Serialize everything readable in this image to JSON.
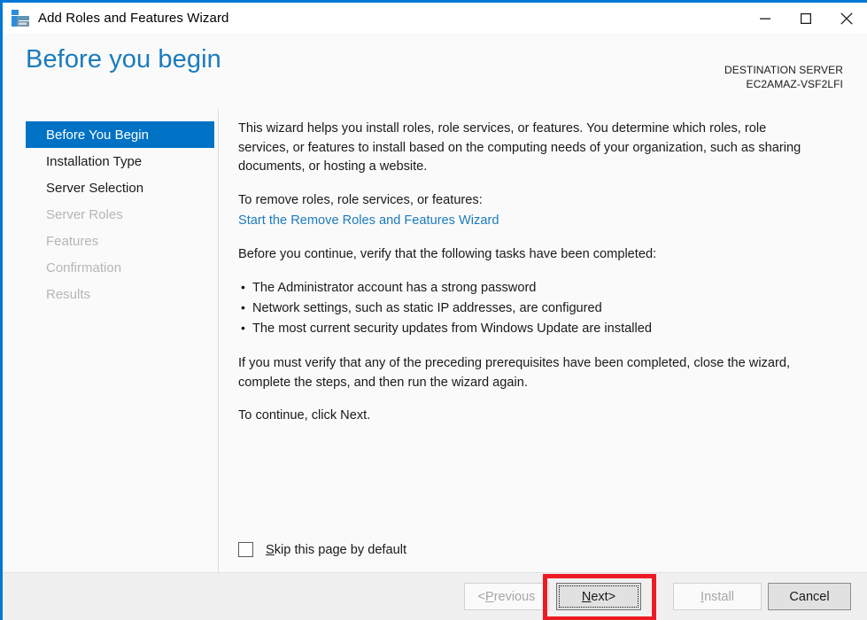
{
  "window": {
    "title": "Add Roles and Features Wizard",
    "icon": "server-roles-icon",
    "accent_color": "#0078d7",
    "controls": {
      "minimize": "minimize-icon",
      "maximize": "maximize-icon",
      "close": "close-icon"
    }
  },
  "header": {
    "page_title": "Before you begin",
    "title_color": "#1b7bbd",
    "destination_label": "DESTINATION SERVER",
    "destination_value": "EC2AMAZ-VSF2LFI"
  },
  "sidebar": {
    "selected_color": "#0072c6",
    "items": [
      {
        "label": "Before You Begin",
        "state": "selected"
      },
      {
        "label": "Installation Type",
        "state": "enabled"
      },
      {
        "label": "Server Selection",
        "state": "enabled"
      },
      {
        "label": "Server Roles",
        "state": "disabled"
      },
      {
        "label": "Features",
        "state": "disabled"
      },
      {
        "label": "Confirmation",
        "state": "disabled"
      },
      {
        "label": "Results",
        "state": "disabled"
      }
    ]
  },
  "content": {
    "intro_paragraph": "This wizard helps you install roles, role services, or features. You determine which roles, role services, or features to install based on the computing needs of your organization, such as sharing documents, or hosting a website.",
    "remove_lead_in": "To remove roles, role services, or features:",
    "remove_link": "Start the Remove Roles and Features Wizard",
    "remove_link_color": "#1b7bbd",
    "verify_lead_in": "Before you continue, verify that the following tasks have been completed:",
    "checklist": [
      "The Administrator account has a strong password",
      "Network settings, such as static IP addresses, are configured",
      "The most current security updates from Windows Update are installed"
    ],
    "prereq_paragraph": "If you must verify that any of the preceding prerequisites have been completed, close the wizard, complete the steps, and then run the wizard again.",
    "continue_paragraph": "To continue, click Next.",
    "skip_checkbox": {
      "accel": "S",
      "rest": "kip this page by default",
      "checked": false
    }
  },
  "footer": {
    "buttons": [
      {
        "prefix": "< ",
        "accel": "P",
        "rest": "revious",
        "suffix": "",
        "state": "disabled",
        "name": "previous-button"
      },
      {
        "prefix": "",
        "accel": "N",
        "rest": "ext",
        "suffix": " >",
        "state": "focused",
        "name": "next-button"
      },
      {
        "prefix": "",
        "accel": "I",
        "rest": "nstall",
        "suffix": "",
        "state": "disabled",
        "name": "install-button"
      },
      {
        "prefix": "",
        "accel": "",
        "rest": "Cancel",
        "suffix": "",
        "state": "enabled",
        "name": "cancel-button"
      }
    ]
  },
  "annotation": {
    "type": "red-highlight-rectangle",
    "target": "next-button",
    "color": "#ed1c24"
  }
}
